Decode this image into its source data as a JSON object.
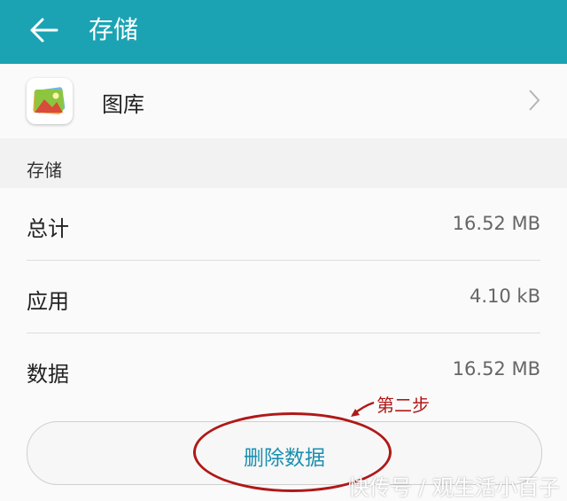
{
  "header": {
    "title": "存储",
    "back_icon": "arrow-left-icon"
  },
  "app": {
    "name": "图库",
    "icon": "gallery-app-icon",
    "chevron_icon": "chevron-right-icon"
  },
  "section": {
    "title": "存储"
  },
  "rows": [
    {
      "label": "总计",
      "value": "16.52 MB"
    },
    {
      "label": "应用",
      "value": "4.10 kB"
    },
    {
      "label": "数据",
      "value": "16.52 MB"
    }
  ],
  "delete_button": {
    "label": "删除数据"
  },
  "annotation": {
    "text": "第二步",
    "color": "#b01818"
  },
  "watermark": "快传号 / 观生活小百子",
  "colors": {
    "accent": "#1ba3b3",
    "button_text": "#1a8fb0"
  }
}
